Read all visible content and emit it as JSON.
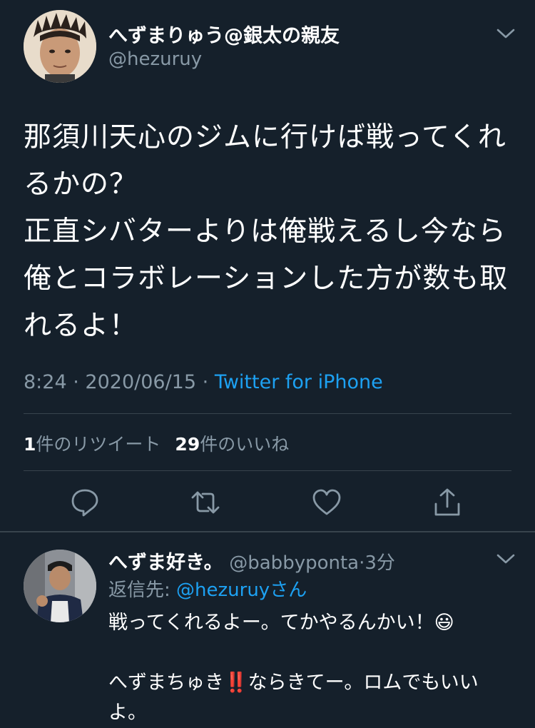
{
  "main_tweet": {
    "author_name": "へずまりゅう@銀太の親友",
    "author_handle": "@hezuruy",
    "text": "那須川天心のジムに行けば戦ってくれるかの？\n正直シバターよりは俺戦えるし今なら俺とコラボレーションした方が数も取れるよ！",
    "time": "8:24",
    "date": "2020/06/15",
    "separator": "·",
    "source": "Twitter for iPhone",
    "retweet_count": "1",
    "retweet_label": "件のリツイート",
    "like_count": "29",
    "like_label": "件のいいね"
  },
  "reply_tweet": {
    "author_name": "へずま好き。",
    "author_handle": "@babbyponta",
    "separator": "·",
    "time_ago": "3分",
    "replying_prefix": "返信先: ",
    "replying_mention": "@hezuruy",
    "replying_suffix": "さん",
    "line1": "戦ってくれるよー。てかやるんかい！😃",
    "line2": "へずまちゅき‼️ならきてー。ロムでもいい",
    "line3": "よ。"
  },
  "icons": {
    "chevron": "chevron-down-icon",
    "reply": "reply-icon",
    "retweet": "retweet-icon",
    "like": "heart-icon",
    "share": "share-icon"
  },
  "colors": {
    "background": "#15202b",
    "text": "#ffffff",
    "secondary": "#8899a6",
    "accent": "#1da1f2",
    "divider": "#38444d"
  }
}
